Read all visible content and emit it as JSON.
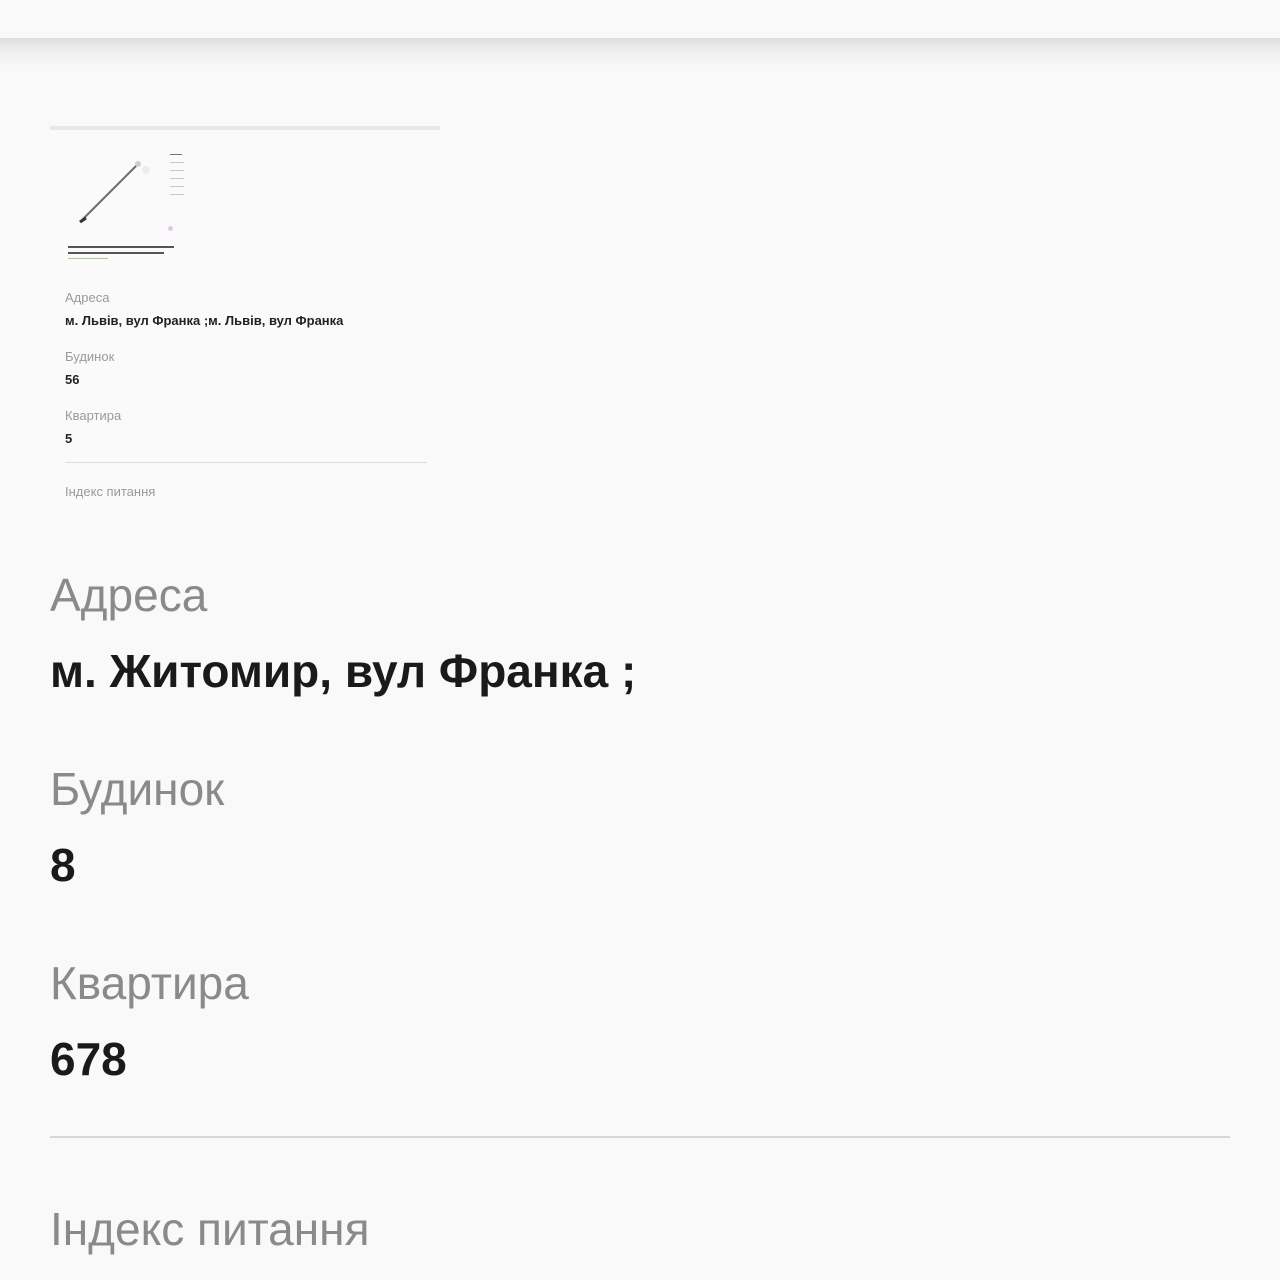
{
  "thumbnail": {
    "address_label": "Адреса",
    "address_value": "м. Львів, вул Франка ;м. Львів, вул Франка",
    "house_label": "Будинок",
    "house_value": "56",
    "apartment_label": "Квартира",
    "apartment_value": "5",
    "index_label": "Індекс питання"
  },
  "fields": {
    "address_label": "Адреса",
    "address_value": "м. Житомир, вул Франка ;",
    "house_label": "Будинок",
    "house_value": "8",
    "apartment_label": "Квартира",
    "apartment_value": "678",
    "index_label": "Індекс питання"
  }
}
